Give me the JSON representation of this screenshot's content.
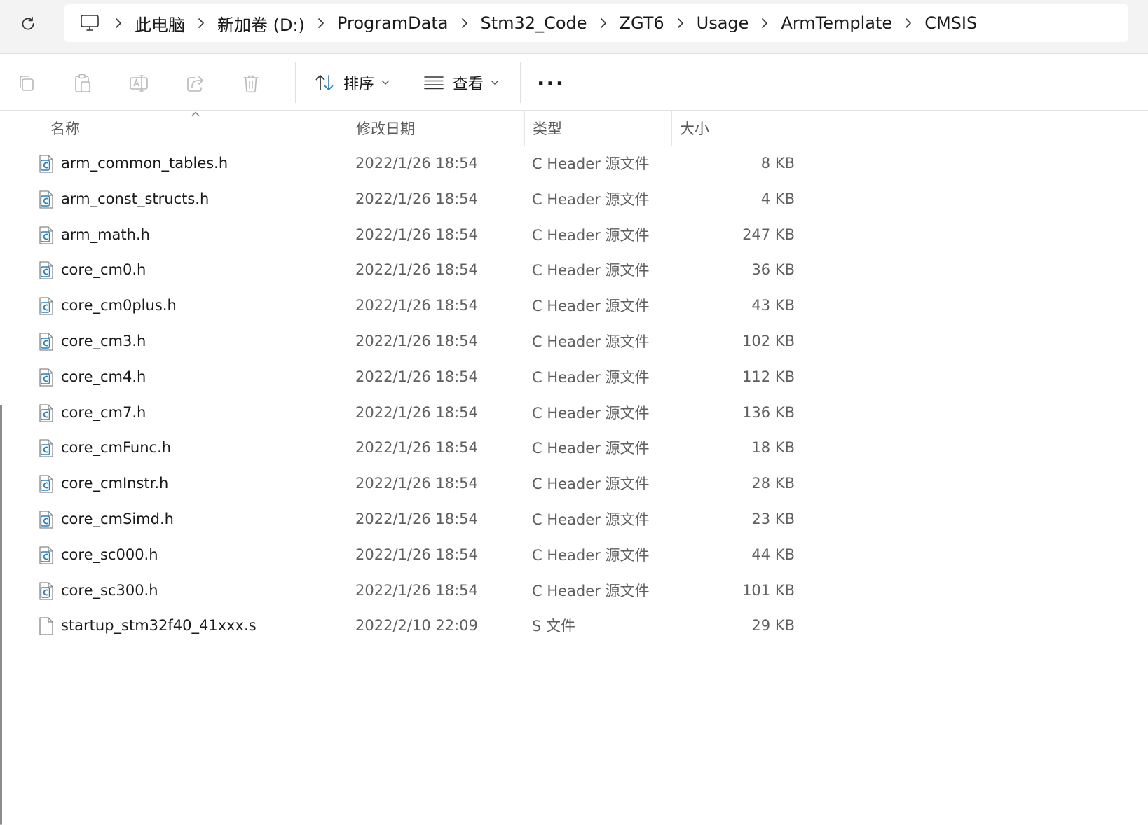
{
  "breadcrumb": {
    "items": [
      "此电脑",
      "新加卷 (D:)",
      "ProgramData",
      "Stm32_Code",
      "ZGT6",
      "Usage",
      "ArmTemplate",
      "CMSIS"
    ]
  },
  "toolbar": {
    "sort_label": "排序",
    "view_label": "查看",
    "more_label": "..."
  },
  "columns": {
    "name": "名称",
    "date": "修改日期",
    "type": "类型",
    "size": "大小"
  },
  "files": [
    {
      "name": "arm_common_tables.h",
      "date": "2022/1/26 18:54",
      "type": "C Header 源文件",
      "size": "8 KB",
      "icon": "c-file-icon"
    },
    {
      "name": "arm_const_structs.h",
      "date": "2022/1/26 18:54",
      "type": "C Header 源文件",
      "size": "4 KB",
      "icon": "c-file-icon"
    },
    {
      "name": "arm_math.h",
      "date": "2022/1/26 18:54",
      "type": "C Header 源文件",
      "size": "247 KB",
      "icon": "c-file-icon"
    },
    {
      "name": "core_cm0.h",
      "date": "2022/1/26 18:54",
      "type": "C Header 源文件",
      "size": "36 KB",
      "icon": "c-file-icon"
    },
    {
      "name": "core_cm0plus.h",
      "date": "2022/1/26 18:54",
      "type": "C Header 源文件",
      "size": "43 KB",
      "icon": "c-file-icon"
    },
    {
      "name": "core_cm3.h",
      "date": "2022/1/26 18:54",
      "type": "C Header 源文件",
      "size": "102 KB",
      "icon": "c-file-icon"
    },
    {
      "name": "core_cm4.h",
      "date": "2022/1/26 18:54",
      "type": "C Header 源文件",
      "size": "112 KB",
      "icon": "c-file-icon"
    },
    {
      "name": "core_cm7.h",
      "date": "2022/1/26 18:54",
      "type": "C Header 源文件",
      "size": "136 KB",
      "icon": "c-file-icon"
    },
    {
      "name": "core_cmFunc.h",
      "date": "2022/1/26 18:54",
      "type": "C Header 源文件",
      "size": "18 KB",
      "icon": "c-file-icon"
    },
    {
      "name": "core_cmInstr.h",
      "date": "2022/1/26 18:54",
      "type": "C Header 源文件",
      "size": "28 KB",
      "icon": "c-file-icon"
    },
    {
      "name": "core_cmSimd.h",
      "date": "2022/1/26 18:54",
      "type": "C Header 源文件",
      "size": "23 KB",
      "icon": "c-file-icon"
    },
    {
      "name": "core_sc000.h",
      "date": "2022/1/26 18:54",
      "type": "C Header 源文件",
      "size": "44 KB",
      "icon": "c-file-icon"
    },
    {
      "name": "core_sc300.h",
      "date": "2022/1/26 18:54",
      "type": "C Header 源文件",
      "size": "101 KB",
      "icon": "c-file-icon"
    },
    {
      "name": "startup_stm32f40_41xxx.s",
      "date": "2022/2/10 22:09",
      "type": "S 文件",
      "size": "29 KB",
      "icon": "generic-file-icon"
    }
  ],
  "colors": {
    "c_icon": "#2f7fb5",
    "icon_gray": "#9a9a9a",
    "muted_text": "#5f5f5f"
  }
}
